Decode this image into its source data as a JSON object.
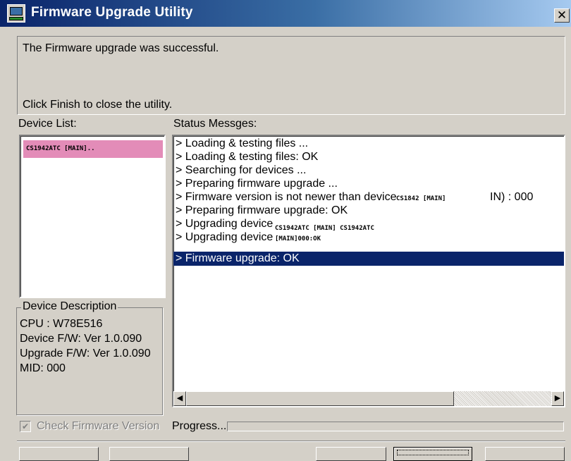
{
  "window": {
    "title": "Firmware Upgrade Utility",
    "close_glyph": "✕",
    "icon": "firmware-utility-icon"
  },
  "message": {
    "line1": "The Firmware upgrade was successful.",
    "line2": "Click Finish to close the utility."
  },
  "device_list": {
    "label": "Device List:",
    "items": [
      {
        "name": "CS1942ATC [MAIN]..",
        "highlight_color": "#e38cb8"
      }
    ]
  },
  "device_description": {
    "legend": "Device Description",
    "cpu": "CPU : W78E516",
    "device_fw": "Device F/W: Ver 1.0.090",
    "upgrade_fw": "Upgrade F/W: Ver 1.0.090",
    "mid": "MID: 000"
  },
  "status": {
    "label": "Status Messges:",
    "messages": [
      "> Loading & testing files ...",
      "> Loading & testing files: OK",
      "> Searching for devices ...",
      "> Preparing firmware upgrade ...",
      "> Firmware version is not newer than device",
      "> Preparing firmware upgrade: OK",
      "> Upgrading device",
      "> Upgrading device",
      "> Firmware upgrade: OK"
    ],
    "fw_device_tag": "CS1842 [MAIN]",
    "fw_suffix": "IN) : 000",
    "upgrade_tag_line1": "CS1942ATC [MAIN]  CS1942ATC",
    "upgrade_tag_line2": "[MAIN]000:OK",
    "selected_index": 8,
    "selection_color": "#0a246a"
  },
  "options": {
    "check_firmware_label": "Check Firmware Version",
    "check_firmware_checked": true,
    "check_firmware_enabled": false
  },
  "progress": {
    "label": "Progress...",
    "value": 0
  }
}
